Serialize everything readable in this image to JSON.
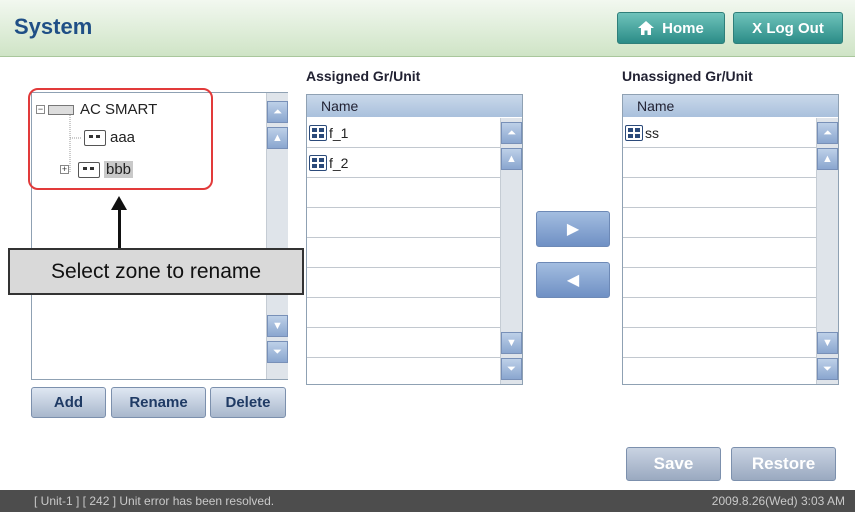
{
  "header": {
    "title": "System",
    "home_label": "Home",
    "logout_label": "X Log Out"
  },
  "tree": {
    "root_label": "AC SMART",
    "nodes": [
      {
        "label": "aaa"
      },
      {
        "label": "bbb",
        "selected": true
      }
    ],
    "buttons": {
      "add": "Add",
      "rename": "Rename",
      "delete": "Delete"
    }
  },
  "assigned": {
    "title": "Assigned Gr/Unit",
    "column": "Name",
    "rows": [
      "f_1",
      "f_2"
    ]
  },
  "unassigned": {
    "title": "Unassigned Gr/Unit",
    "column": "Name",
    "rows": [
      "ss"
    ]
  },
  "actions": {
    "save": "Save",
    "restore": "Restore"
  },
  "callout": {
    "text": "Select zone to rename"
  },
  "status": {
    "message": "[ Unit-1 ] [ 242 ] Unit error has been resolved.",
    "datetime": "2009.8.26(Wed)  3:03 AM"
  },
  "colors": {
    "accent_red": "#e23a3a",
    "header_blue": "#1f4f86",
    "teal": "#2b8c87"
  }
}
